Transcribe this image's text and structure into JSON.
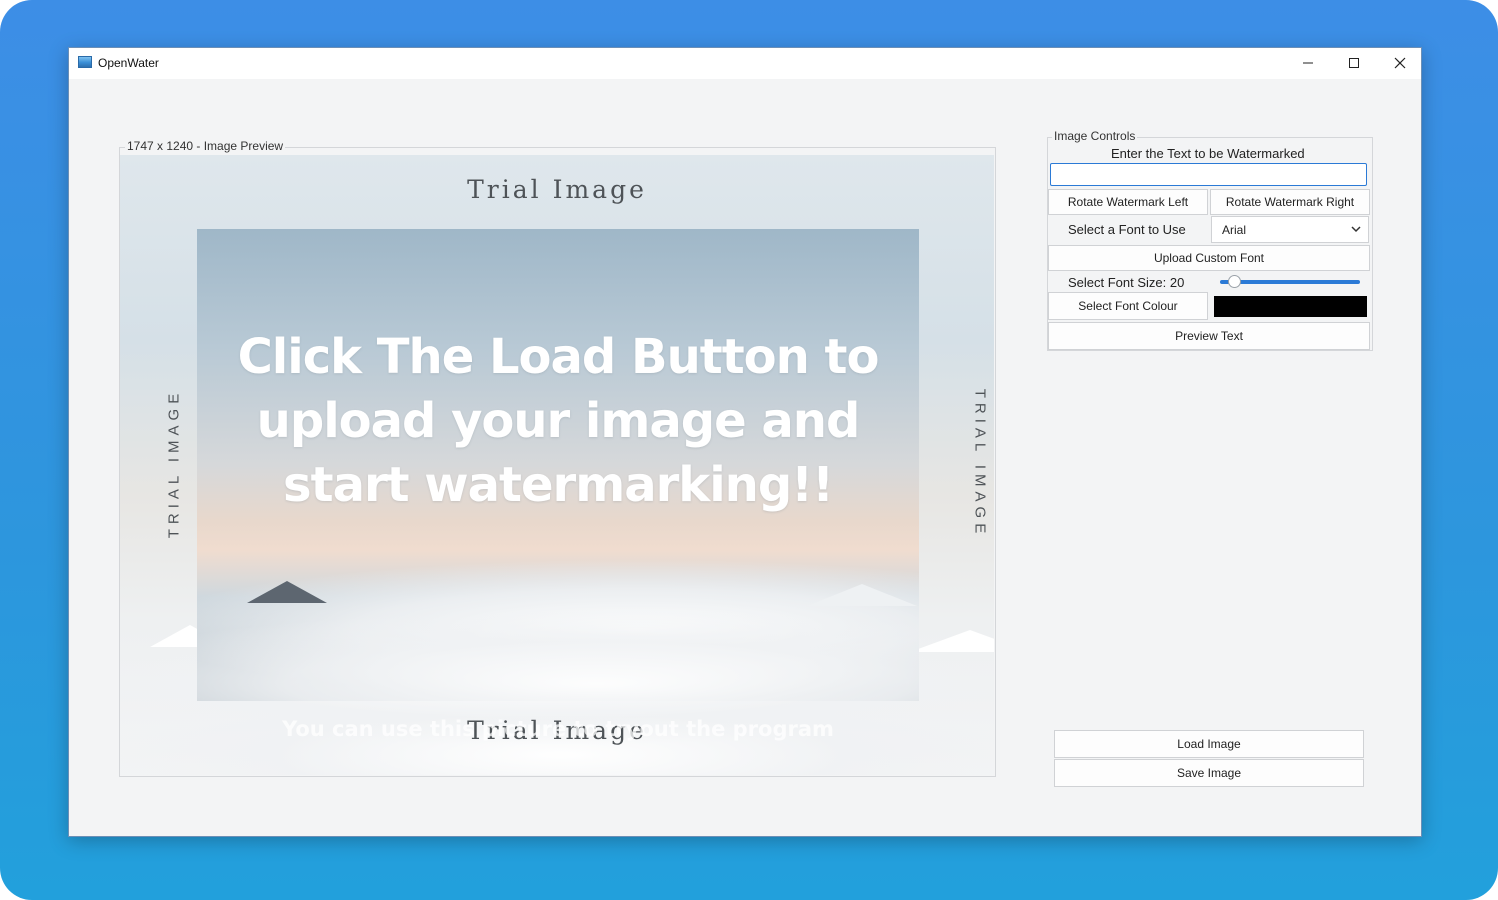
{
  "window": {
    "title": "OpenWater",
    "controls": {
      "minimize": "minimize-icon",
      "maximize": "maximize-icon",
      "close": "close-icon"
    }
  },
  "preview": {
    "legend": "1747 x 1240 - Image Preview",
    "image": {
      "trial_top": "Trial Image",
      "trial_bottom": "Trial Image",
      "trial_left": "TRIAL IMAGE",
      "trial_right": "TRIAL IMAGE",
      "headline": "Click The Load Button to upload your image and start watermarking!!",
      "subline": "You can use this picture to tryout the program"
    }
  },
  "controls": {
    "legend": "Image Controls",
    "text_label": "Enter the Text to be Watermarked",
    "text_value": "",
    "rotate_left": "Rotate Watermark Left",
    "rotate_right": "Rotate Watermark Right",
    "font_label": "Select a Font to Use",
    "font_value": "Arial",
    "upload_font": "Upload Custom Font",
    "font_size_label": "Select Font Size: 20",
    "font_size_fraction": 0.1,
    "font_colour_button": "Select Font Colour",
    "font_colour": "#000000",
    "preview_text": "Preview Text"
  },
  "actions": {
    "load_image": "Load Image",
    "save_image": "Save Image"
  },
  "colors": {
    "accent": "#2b7ad6",
    "window_bg": "#f3f4f5"
  }
}
